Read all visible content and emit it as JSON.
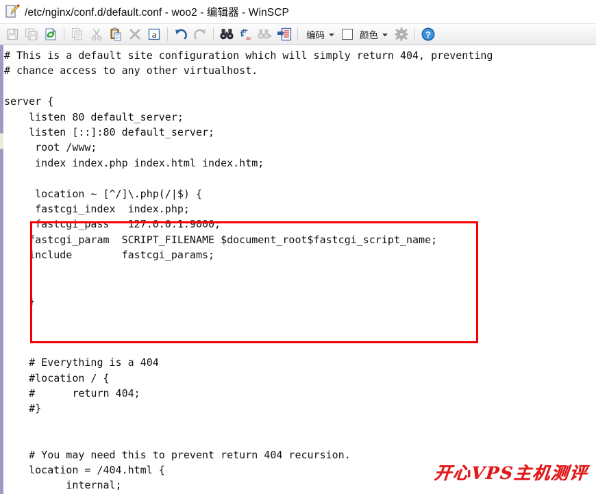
{
  "window": {
    "title": "/etc/nginx/conf.d/default.conf - woo2 - 编辑器 - WinSCP",
    "icon": "editor-document-pencil-icon"
  },
  "toolbar": {
    "buttons": [
      {
        "name": "save-button",
        "icon": "floppy-disk-icon",
        "enabled": false
      },
      {
        "name": "save-as-button",
        "icon": "floppy-disk-copy-icon",
        "enabled": false
      },
      {
        "name": "reload-button",
        "icon": "refresh-arrows-icon",
        "enabled": true
      },
      {
        "name": "copy-button",
        "icon": "copy-pages-icon",
        "enabled": false
      },
      {
        "name": "cut-button",
        "icon": "scissors-icon",
        "enabled": false
      },
      {
        "name": "paste-button",
        "icon": "clipboard-paste-icon",
        "enabled": true
      },
      {
        "name": "delete-button",
        "icon": "x-cross-icon",
        "enabled": false
      },
      {
        "name": "select-all-button",
        "icon": "letter-a-box-icon",
        "enabled": true
      },
      {
        "name": "undo-button",
        "icon": "undo-arrow-icon",
        "enabled": true
      },
      {
        "name": "redo-button",
        "icon": "redo-arrow-icon",
        "enabled": false
      },
      {
        "name": "find-button",
        "icon": "binoculars-icon",
        "enabled": true
      },
      {
        "name": "replace-button",
        "icon": "ab-ac-replace-icon",
        "enabled": true
      },
      {
        "name": "find-next-button",
        "icon": "binoculars-next-icon",
        "enabled": false
      },
      {
        "name": "go-to-line-button",
        "icon": "goto-line-icon",
        "enabled": true
      }
    ],
    "encoding_label": "编码",
    "color_label": "颜色",
    "color_swatch": "#ffffff",
    "preferences_icon": "gear-icon",
    "help_icon": "question-mark-circle-icon"
  },
  "editor": {
    "language": "nginx-conf",
    "scrollbar": {
      "orientation": "vertical",
      "position": "left"
    },
    "content": "# This is a default site configuration which will simply return 404, preventing\n# chance access to any other virtualhost.\n\nserver {\n    listen 80 default_server;\n    listen [::]:80 default_server;\n     root /www;\n     index index.php index.html index.htm;\n\n     location ~ [^/]\\.php(/|$) {\n     fastcgi_index  index.php;\n     fastcgi_pass   127.0.0.1:9000;\n    fastcgi_param  SCRIPT_FILENAME $document_root$fastcgi_script_name;\n    include        fastcgi_params;\n\n\n    }\n\n\n\n    # Everything is a 404\n    #location / {\n    #      return 404;\n    #}\n\n\n    # You may need this to prevent return 404 recursion.\n    location = /404.html {\n          internal;\n    }\n}"
  },
  "annotation": {
    "type": "highlight-rectangle",
    "color": "#f40000",
    "encloses": "php-fastcgi-location-block"
  },
  "watermark": {
    "text": "开心VPS主机测评",
    "color": "#e01b1b"
  }
}
